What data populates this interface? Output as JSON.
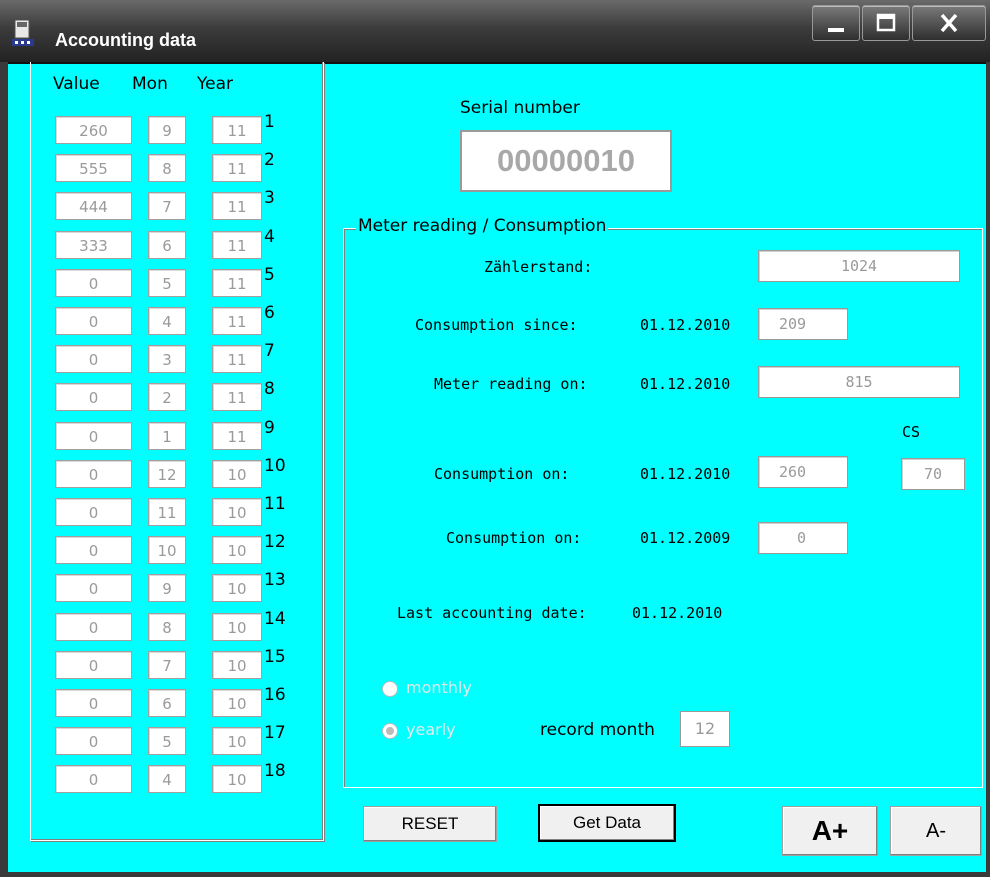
{
  "window": {
    "title": "Accounting data",
    "controls": [
      "minimize-icon",
      "maximize-icon",
      "close-icon"
    ]
  },
  "history": {
    "headers": {
      "value": "Value",
      "month": "Mon",
      "year": "Year"
    },
    "rows": [
      {
        "num": "1",
        "value": "260",
        "month": "9",
        "year": "11"
      },
      {
        "num": "2",
        "value": "555",
        "month": "8",
        "year": "11"
      },
      {
        "num": "3",
        "value": "444",
        "month": "7",
        "year": "11"
      },
      {
        "num": "4",
        "value": "333",
        "month": "6",
        "year": "11"
      },
      {
        "num": "5",
        "value": "0",
        "month": "5",
        "year": "11"
      },
      {
        "num": "6",
        "value": "0",
        "month": "4",
        "year": "11"
      },
      {
        "num": "7",
        "value": "0",
        "month": "3",
        "year": "11"
      },
      {
        "num": "8",
        "value": "0",
        "month": "2",
        "year": "11"
      },
      {
        "num": "9",
        "value": "0",
        "month": "1",
        "year": "11"
      },
      {
        "num": "10",
        "value": "0",
        "month": "12",
        "year": "10"
      },
      {
        "num": "11",
        "value": "0",
        "month": "11",
        "year": "10"
      },
      {
        "num": "12",
        "value": "0",
        "month": "10",
        "year": "10"
      },
      {
        "num": "13",
        "value": "0",
        "month": "9",
        "year": "10"
      },
      {
        "num": "14",
        "value": "0",
        "month": "8",
        "year": "10"
      },
      {
        "num": "15",
        "value": "0",
        "month": "7",
        "year": "10"
      },
      {
        "num": "16",
        "value": "0",
        "month": "6",
        "year": "10"
      },
      {
        "num": "17",
        "value": "0",
        "month": "5",
        "year": "10"
      },
      {
        "num": "18",
        "value": "0",
        "month": "4",
        "year": "10"
      }
    ]
  },
  "serial": {
    "label": "Serial number",
    "value": "00000010"
  },
  "meter": {
    "legend": "Meter reading / Consumption",
    "zaehlerstand_label": "Zählerstand:",
    "zaehlerstand_value": "1024",
    "consumption_since_label": "Consumption since:",
    "consumption_since_date": "01.12.2010",
    "consumption_since_value": "209",
    "reading_on_label": "Meter reading on:",
    "reading_on_date": "01.12.2010",
    "reading_on_value": "815",
    "cs_label": "CS",
    "consumption_on1_label": "Consumption on:",
    "consumption_on1_date": "01.12.2010",
    "consumption_on1_value": "260",
    "cs_value": "70",
    "consumption_on2_label": "Consumption on:",
    "consumption_on2_date": "01.12.2009",
    "consumption_on2_value": "0",
    "last_date_label": "Last accounting date:",
    "last_date_value": "01.12.2010"
  },
  "options": {
    "monthly_label": "monthly",
    "yearly_label": "yearly",
    "selected": "yearly",
    "record_month_label": "record month",
    "record_month_value": "12"
  },
  "buttons": {
    "reset": "RESET",
    "get_data": "Get Data",
    "font_plus": "A+",
    "font_minus": "A-"
  },
  "colors": {
    "background": "#00ffff",
    "titlebar": "#3c3c3c"
  }
}
